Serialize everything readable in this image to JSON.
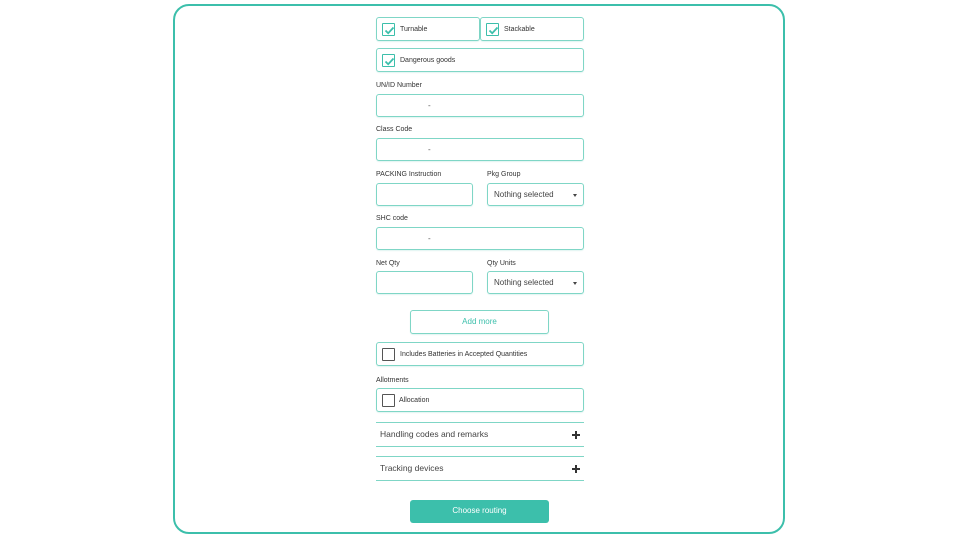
{
  "colors": {
    "accent": "#3cbfab",
    "border": "#7fd6c6",
    "text": "#333333"
  },
  "checkboxes": {
    "turnable": {
      "label": "Turnable",
      "checked": true
    },
    "stackable": {
      "label": "Stackable",
      "checked": true
    },
    "dangerous_goods": {
      "label": "Dangerous goods",
      "checked": true
    },
    "includes_batteries": {
      "label": "Includes Batteries in Accepted Quantities",
      "checked": false
    },
    "allocation": {
      "label": "Allocation",
      "checked": false
    }
  },
  "fields": {
    "un_id_number": {
      "label": "UN/ID Number",
      "value": "-"
    },
    "class_code": {
      "label": "Class Code",
      "value": "-"
    },
    "packing_instruction": {
      "label": "PACKING Instruction",
      "value": ""
    },
    "pkg_group": {
      "label": "Pkg Group",
      "selected": "Nothing selected"
    },
    "shc_code": {
      "label": "SHC code",
      "value": "-"
    },
    "net_qty": {
      "label": "Net Qty",
      "value": ""
    },
    "qty_units": {
      "label": "Qty Units",
      "selected": "Nothing selected"
    }
  },
  "add_more_label": "Add more",
  "allotments_label": "Allotments",
  "accordions": {
    "handling": {
      "title": "Handling codes and remarks",
      "icon": "plus-icon"
    },
    "tracking": {
      "title": "Tracking devices",
      "icon": "plus-icon"
    }
  },
  "choose_routing_label": "Choose routing"
}
